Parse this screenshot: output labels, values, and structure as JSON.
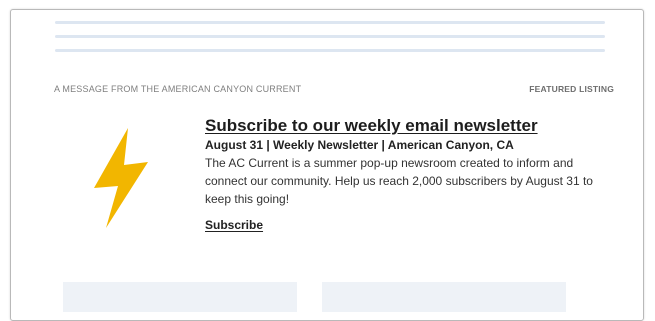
{
  "message_label": "A MESSAGE FROM THE AMERICAN CANYON CURRENT",
  "featured_label": "FEATURED LISTING",
  "listing": {
    "icon": "lightning-bolt-icon",
    "icon_color": "#F2B600",
    "headline": "Subscribe to our weekly email newsletter",
    "dateline": "August 31 | Weekly Newsletter | American Canyon, CA",
    "description": "The AC Current is a summer pop-up newsroom created to inform and connect our community. Help us reach 2,000 subscribers by August 31 to keep this going!",
    "cta_label": "Subscribe"
  },
  "colors": {
    "placeholder_line": "#DDE6F1",
    "card_background": "#EEF2F7"
  }
}
